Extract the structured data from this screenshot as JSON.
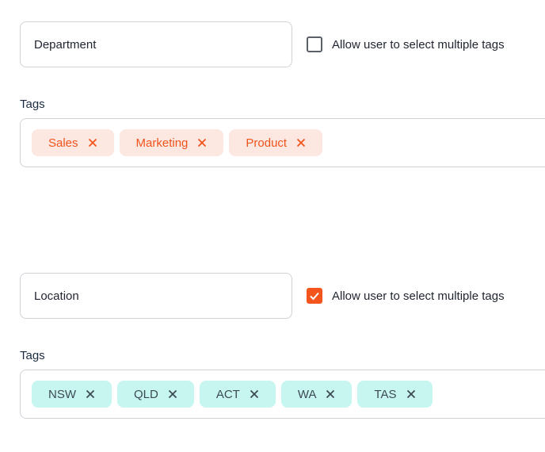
{
  "groups": [
    {
      "name_value": "Department",
      "multi_select_label": "Allow user to select multiple tags",
      "multi_select_checked": false,
      "tags_label": "Tags",
      "tags": [
        "Sales",
        "Marketing",
        "Product"
      ],
      "chip_color": "#fde8e1",
      "chip_text_color": "#f0531c"
    },
    {
      "name_value": "Location",
      "multi_select_label": "Allow user to select multiple tags",
      "multi_select_checked": true,
      "tags_label": "Tags",
      "tags": [
        "NSW",
        "QLD",
        "ACT",
        "WA",
        "TAS"
      ],
      "chip_color": "#c6f6ef",
      "chip_text_color": "#3d4a55"
    }
  ],
  "colors": {
    "accent": "#f4551d",
    "border": "#cfd3d8"
  },
  "icons": {
    "remove": "close-icon",
    "check": "checkmark-icon"
  }
}
